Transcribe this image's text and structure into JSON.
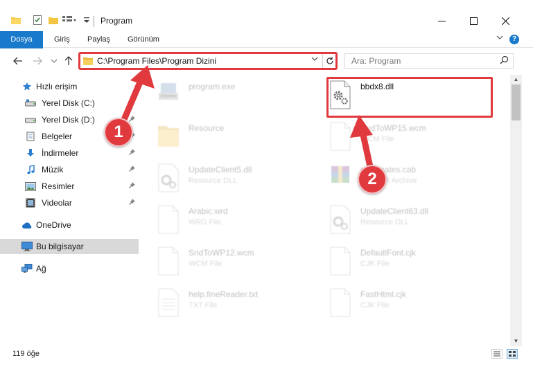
{
  "window": {
    "title": "Program",
    "controls": [
      "minimize",
      "maximize",
      "close"
    ]
  },
  "ribbon": {
    "tabs": [
      "Dosya",
      "Giriş",
      "Paylaş",
      "Görünüm"
    ],
    "help_label": "?"
  },
  "address": {
    "path": "C:\\Program Files\\Program Dizini",
    "search_placeholder": "Ara: Program"
  },
  "sidebar": {
    "quick_access": "Hızlı erişim",
    "items": [
      {
        "label": "Yerel Disk (C:)",
        "icon": "drive-icon",
        "pinned": false
      },
      {
        "label": "Yerel Disk (D:)",
        "icon": "drive-icon",
        "pinned": true
      },
      {
        "label": "Belgeler",
        "icon": "documents-icon",
        "pinned": true
      },
      {
        "label": "İndirmeler",
        "icon": "download-icon",
        "pinned": true
      },
      {
        "label": "Müzik",
        "icon": "music-icon",
        "pinned": true
      },
      {
        "label": "Resimler",
        "icon": "pictures-icon",
        "pinned": true
      },
      {
        "label": "Videolar",
        "icon": "videos-icon",
        "pinned": true
      }
    ],
    "onedrive": "OneDrive",
    "this_pc": "Bu bilgisayar",
    "network": "Ağ"
  },
  "files": {
    "left": [
      {
        "name": "program.exe",
        "type": "",
        "icon": "exe-icon"
      },
      {
        "name": "Resource",
        "type": "",
        "icon": "folder-icon"
      },
      {
        "name": "UpdateClient5.dll",
        "type": "Resource DLL",
        "icon": "dll-icon"
      },
      {
        "name": "Arabic.wrd",
        "type": "WRD File",
        "icon": "file-icon"
      },
      {
        "name": "SndToWP12.wcm",
        "type": "WCM File",
        "icon": "file-icon"
      },
      {
        "name": "help.fineReader.txt",
        "type": "TXT File",
        "icon": "text-icon"
      }
    ],
    "right": [
      {
        "name": "bbdx8.dll",
        "type": "",
        "icon": "dll-icon"
      },
      {
        "name": "SndToWP15.wcm",
        "type": "WCM File",
        "icon": "file-icon"
      },
      {
        "name": "certificates.cab",
        "type": "WinRAR Archive",
        "icon": "archive-icon"
      },
      {
        "name": "UpdateClient63.dll",
        "type": "Resource DLL",
        "icon": "dll-icon"
      },
      {
        "name": "DefaultFont.cjk",
        "type": "CJK File",
        "icon": "file-icon"
      },
      {
        "name": "FastHtml.cjk",
        "type": "CJK File",
        "icon": "file-icon"
      }
    ]
  },
  "status": {
    "count": "119 öğe"
  },
  "annotations": {
    "step1": "1",
    "step2": "2",
    "color": "#e0393e"
  }
}
